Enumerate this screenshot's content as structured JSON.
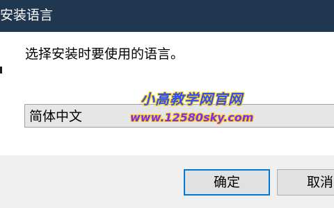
{
  "window": {
    "title": "安装语言"
  },
  "dialog": {
    "prompt": "选择安装时要使用的语言。",
    "language_select": {
      "selected": "简体中文"
    },
    "buttons": {
      "ok_label": "确定",
      "cancel_label": "取消"
    }
  },
  "watermark": {
    "site_name": "小高教学网官网",
    "url": "www.12580sky.com"
  },
  "colors": {
    "titlebar": "#1f3750",
    "accent": "#0078d7"
  }
}
